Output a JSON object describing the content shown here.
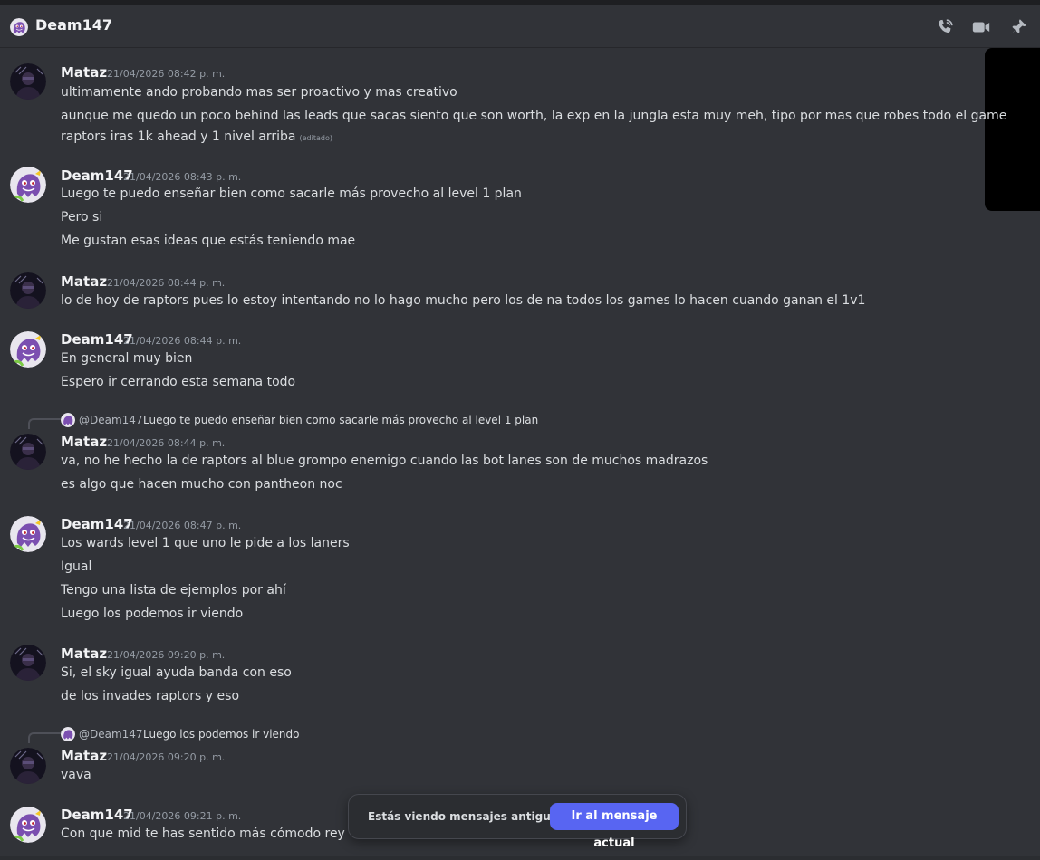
{
  "header": {
    "title": "Deam147",
    "call_icon": "phone-call-icon",
    "video_icon": "video-camera-icon",
    "pin_icon": "pin-icon"
  },
  "users": {
    "mataz": {
      "name": "Mataz",
      "avatar": "dark-portrait-avatar"
    },
    "deam": {
      "name": "Deam147",
      "avatar": "purple-ghost-avatar"
    }
  },
  "messages": [
    {
      "author": "Mataz",
      "timestamp": "21/04/2026 08:42 p. m.",
      "lines": [
        "ultimamente ando probando mas ser proactivo y mas creativo",
        "aunque me quedo un poco behind las leads que sacas siento que son worth,  la exp en la jungla esta muy meh, tipo por mas que robes todo el game",
        "raptors iras 1k ahead y 1 nivel arriba"
      ],
      "edited_label": "(editado)"
    },
    {
      "author": "Deam147",
      "timestamp": "21/04/2026 08:43 p. m.",
      "lines": [
        "Luego te puedo enseñar bien como sacarle más provecho al level 1 plan",
        "Pero si",
        "Me gustan esas ideas que estás teniendo mae"
      ]
    },
    {
      "author": "Mataz",
      "timestamp": "21/04/2026 08:44 p. m.",
      "lines": [
        "lo de hoy de raptors pues lo estoy intentando no lo hago mucho pero los de na todos los games lo hacen cuando ganan el 1v1"
      ]
    },
    {
      "author": "Deam147",
      "timestamp": "21/04/2026 08:44 p. m.",
      "lines": [
        "En general muy bien",
        "Espero ir cerrando esta semana todo"
      ]
    },
    {
      "author": "Mataz",
      "timestamp": "21/04/2026 08:44 p. m.",
      "reply_to": {
        "mention": "@Deam147",
        "text": "Luego te puedo enseñar bien como sacarle más provecho al level 1 plan"
      },
      "lines": [
        "va, no he hecho la de raptors al blue grompo enemigo cuando las bot lanes son de muchos madrazos",
        "es algo que hacen mucho con pantheon noc"
      ]
    },
    {
      "author": "Deam147",
      "timestamp": "21/04/2026 08:47 p. m.",
      "lines": [
        "Los wards level 1 que uno le pide a los laners",
        "Igual",
        "Tengo una lista de ejemplos por ahí",
        "Luego los podemos ir viendo"
      ]
    },
    {
      "author": "Mataz",
      "timestamp": "21/04/2026 09:20 p. m.",
      "lines": [
        "Si, el sky igual ayuda banda con eso",
        "de los invades raptors y eso"
      ]
    },
    {
      "author": "Mataz",
      "timestamp": "21/04/2026 09:20 p. m.",
      "reply_to": {
        "mention": "@Deam147",
        "text": "Luego los podemos ir viendo"
      },
      "lines": [
        "vava"
      ]
    },
    {
      "author": "Deam147",
      "timestamp": "21/04/2026 09:21 p. m.",
      "lines": [
        "Con que mid te has sentido más cómodo rey"
      ]
    }
  ],
  "old_messages_banner": {
    "label": "Estás viendo mensajes antiguos",
    "button": "Ir al mensaje actual",
    "accent": "#5865f2"
  }
}
